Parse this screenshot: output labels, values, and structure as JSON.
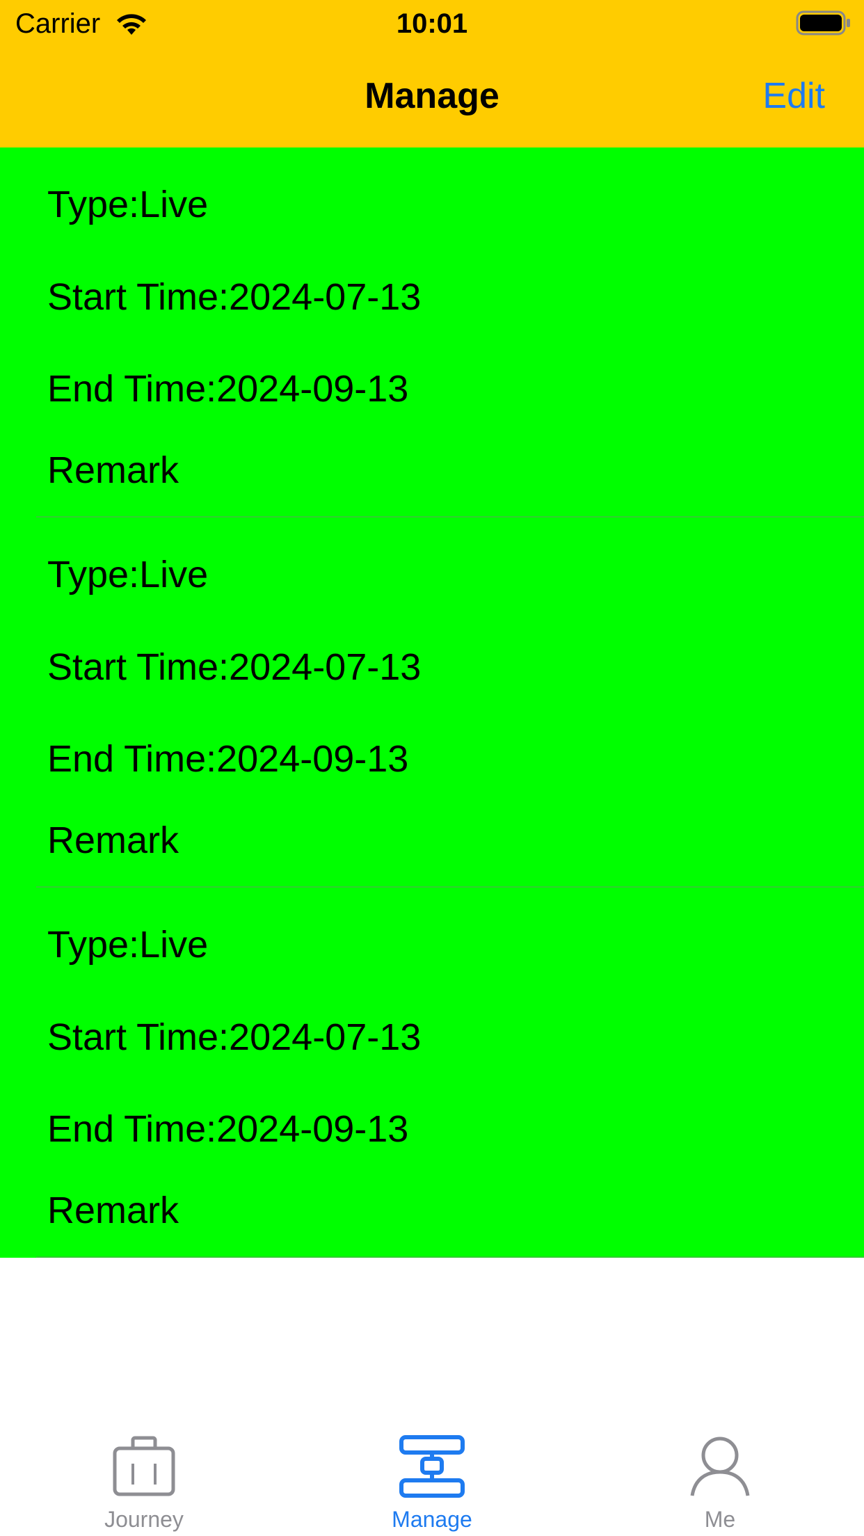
{
  "status_bar": {
    "carrier": "Carrier",
    "time": "10:01"
  },
  "nav": {
    "title": "Manage",
    "edit_label": "Edit"
  },
  "records": [
    {
      "type": "Type:Live",
      "start": "Start Time:2024-07-13",
      "end": "End Time:2024-09-13",
      "remark": "Remark"
    },
    {
      "type": "Type:Live",
      "start": "Start Time:2024-07-13",
      "end": "End Time:2024-09-13",
      "remark": "Remark"
    },
    {
      "type": "Type:Live",
      "start": "Start Time:2024-07-13",
      "end": "End Time:2024-09-13",
      "remark": "Remark"
    }
  ],
  "tabs": [
    {
      "label": "Journey",
      "icon": "suitcase-icon",
      "selected": false
    },
    {
      "label": "Manage",
      "icon": "flowchart-icon",
      "selected": true
    },
    {
      "label": "Me",
      "icon": "person-icon",
      "selected": false
    }
  ],
  "colors": {
    "nav_background": "#ffcc00",
    "cell_background": "#00ff00",
    "accent": "#1e7bf0",
    "tab_inactive": "#8e8e93"
  }
}
